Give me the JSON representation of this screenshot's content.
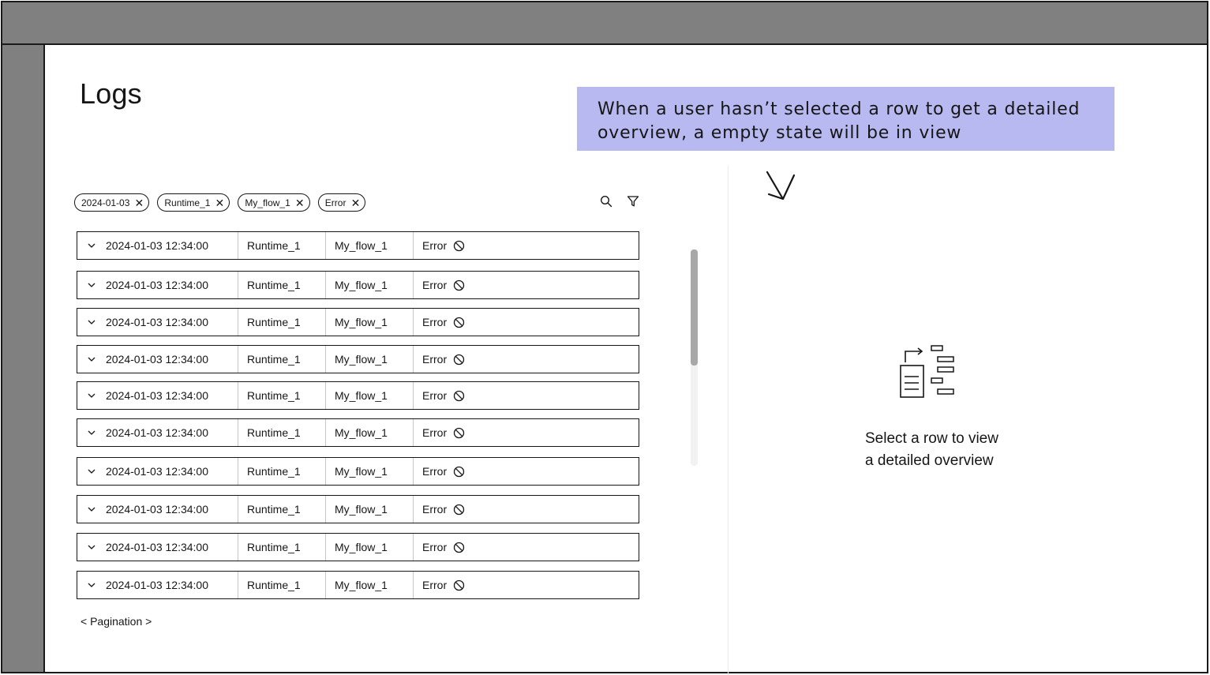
{
  "page": {
    "title": "Logs"
  },
  "annotation": {
    "text": "When a user hasn’t selected a row to get a detailed overview, a empty state will be in view"
  },
  "filters": [
    {
      "label": "2024-01-03",
      "close": "✕"
    },
    {
      "label": "Runtime_1",
      "close": "✕"
    },
    {
      "label": "My_flow_1",
      "close": "✕"
    },
    {
      "label": "Error",
      "close": "✕"
    }
  ],
  "toolbar": {
    "icons": [
      "search-icon",
      "filter-icon"
    ]
  },
  "rows": [
    {
      "datetime": "2024-01-03 12:34:00",
      "runtime": "Runtime_1",
      "flow": "My_flow_1",
      "status": "Error"
    },
    {
      "datetime": "2024-01-03 12:34:00",
      "runtime": "Runtime_1",
      "flow": "My_flow_1",
      "status": "Error"
    },
    {
      "datetime": "2024-01-03 12:34:00",
      "runtime": "Runtime_1",
      "flow": "My_flow_1",
      "status": "Error"
    },
    {
      "datetime": "2024-01-03 12:34:00",
      "runtime": "Runtime_1",
      "flow": "My_flow_1",
      "status": "Error"
    },
    {
      "datetime": "2024-01-03 12:34:00",
      "runtime": "Runtime_1",
      "flow": "My_flow_1",
      "status": "Error"
    },
    {
      "datetime": "2024-01-03 12:34:00",
      "runtime": "Runtime_1",
      "flow": "My_flow_1",
      "status": "Error"
    },
    {
      "datetime": "2024-01-03 12:34:00",
      "runtime": "Runtime_1",
      "flow": "My_flow_1",
      "status": "Error"
    },
    {
      "datetime": "2024-01-03 12:34:00",
      "runtime": "Runtime_1",
      "flow": "My_flow_1",
      "status": "Error"
    },
    {
      "datetime": "2024-01-03 12:34:00",
      "runtime": "Runtime_1",
      "flow": "My_flow_1",
      "status": "Error"
    },
    {
      "datetime": "2024-01-03 12:34:00",
      "runtime": "Runtime_1",
      "flow": "My_flow_1",
      "status": "Error"
    }
  ],
  "pagination": {
    "label": "< Pagination >"
  },
  "empty_state": {
    "line1": "Select a row to view",
    "line2": "a detailed overview",
    "icon": "flow-diagram-icon"
  },
  "colors": {
    "chrome": "#808080",
    "annotation_bg": "#b7b9f0",
    "text": "#161616"
  }
}
